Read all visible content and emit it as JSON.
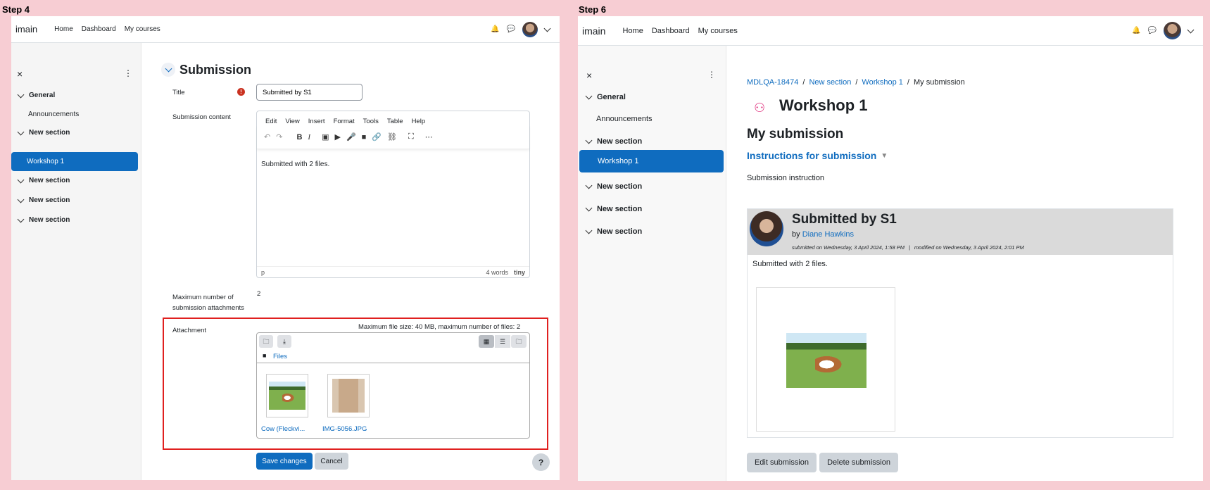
{
  "step4": {
    "label": "Step 4",
    "nav": {
      "brand": "imain",
      "links": [
        "Home",
        "Dashboard",
        "My courses"
      ]
    },
    "drawer": {
      "close": "×",
      "items": [
        {
          "label": "General",
          "type": "section"
        },
        {
          "label": "Announcements",
          "type": "item"
        },
        {
          "label": "New section",
          "type": "section"
        },
        {
          "label": "Workshop 1",
          "type": "active"
        },
        {
          "label": "New section",
          "type": "section"
        },
        {
          "label": "New section",
          "type": "section"
        },
        {
          "label": "New section",
          "type": "section"
        }
      ]
    },
    "form": {
      "heading": "Submission",
      "title_label": "Title",
      "title_value": "Submitted by S1",
      "content_label": "Submission content",
      "menu": [
        "Edit",
        "View",
        "Insert",
        "Format",
        "Tools",
        "Table",
        "Help"
      ],
      "editor_text": "Submitted with 2 files.",
      "status_path": "p",
      "word_count": "4 words",
      "tiny_brand": "tiny",
      "max_label": "Maximum number of submission attachments",
      "max_value": "2",
      "attachment_label": "Attachment",
      "attachment_info": "Maximum file size: 40 MB, maximum number of files: 2",
      "files_label": "Files",
      "files": [
        {
          "name": "Cow (Fleckvi..."
        },
        {
          "name": "IMG-5056.JPG"
        }
      ],
      "save": "Save changes",
      "cancel": "Cancel",
      "help": "?"
    }
  },
  "step6": {
    "label": "Step 6",
    "nav": {
      "brand": "imain",
      "links": [
        "Home",
        "Dashboard",
        "My courses"
      ]
    },
    "drawer": {
      "close": "×",
      "items": [
        {
          "label": "General",
          "type": "section"
        },
        {
          "label": "Announcements",
          "type": "item"
        },
        {
          "label": "New section",
          "type": "section"
        },
        {
          "label": "Workshop 1",
          "type": "active"
        },
        {
          "label": "New section",
          "type": "section"
        },
        {
          "label": "New section",
          "type": "section"
        },
        {
          "label": "New section",
          "type": "section"
        }
      ]
    },
    "breadcrumb": [
      "MDLQA-18474",
      "New section",
      "Workshop 1",
      "My submission"
    ],
    "title": "Workshop 1",
    "subtitle": "My submission",
    "instructions_link": "Instructions for submission",
    "instruction_text": "Submission instruction",
    "submission": {
      "title": "Submitted by S1",
      "by": "by",
      "author": "Diane Hawkins",
      "submitted": "submitted on Wednesday, 3 April 2024, 1:58 PM",
      "modified": "modified on Wednesday, 3 April 2024, 2:01 PM",
      "body": "Submitted with 2 files."
    },
    "edit": "Edit submission",
    "delete": "Delete submission"
  }
}
